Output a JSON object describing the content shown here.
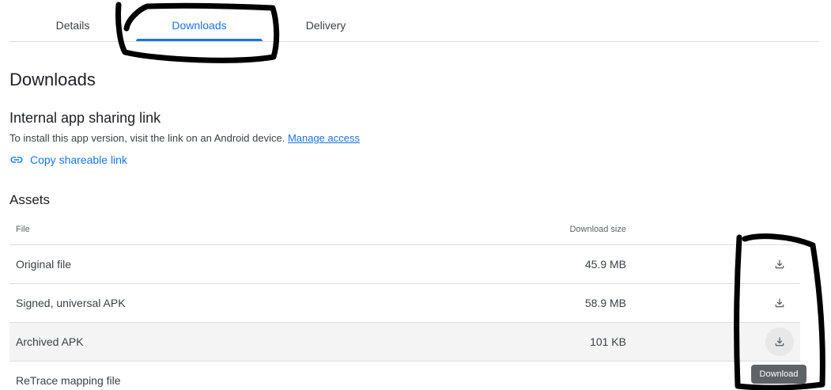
{
  "tabs": [
    {
      "label": "Details"
    },
    {
      "label": "Downloads",
      "active": true
    },
    {
      "label": "Delivery"
    }
  ],
  "page_title": "Downloads",
  "sharing": {
    "title": "Internal app sharing link",
    "description": "To install this app version, visit the link on an Android device.",
    "manage_access_link": "Manage access",
    "copy_link_label": "Copy shareable link",
    "copy_icon": "link-icon"
  },
  "assets": {
    "title": "Assets",
    "columns": {
      "file": "File",
      "size": "Download size"
    },
    "rows": [
      {
        "file": "Original file",
        "size": "45.9 MB"
      },
      {
        "file": "Signed, universal APK",
        "size": "58.9 MB"
      },
      {
        "file": "Archived APK",
        "size": "101 KB",
        "hovered": true
      },
      {
        "file": "ReTrace mapping file",
        "size": ""
      }
    ],
    "download_icon": "download-icon"
  },
  "tooltip": "Download",
  "colors": {
    "accent": "#1a73e8",
    "text": "#202124",
    "annotation": "#000000"
  }
}
